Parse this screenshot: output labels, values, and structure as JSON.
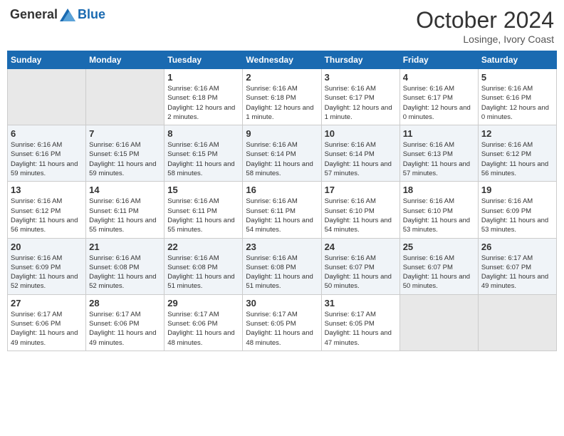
{
  "header": {
    "logo": {
      "general": "General",
      "blue": "Blue"
    },
    "title": "October 2024",
    "location": "Losinge, Ivory Coast"
  },
  "columns": [
    "Sunday",
    "Monday",
    "Tuesday",
    "Wednesday",
    "Thursday",
    "Friday",
    "Saturday"
  ],
  "weeks": [
    [
      {
        "day": "",
        "info": ""
      },
      {
        "day": "",
        "info": ""
      },
      {
        "day": "1",
        "info": "Sunrise: 6:16 AM\nSunset: 6:18 PM\nDaylight: 12 hours\nand 2 minutes."
      },
      {
        "day": "2",
        "info": "Sunrise: 6:16 AM\nSunset: 6:18 PM\nDaylight: 12 hours\nand 1 minute."
      },
      {
        "day": "3",
        "info": "Sunrise: 6:16 AM\nSunset: 6:17 PM\nDaylight: 12 hours\nand 1 minute."
      },
      {
        "day": "4",
        "info": "Sunrise: 6:16 AM\nSunset: 6:17 PM\nDaylight: 12 hours\nand 0 minutes."
      },
      {
        "day": "5",
        "info": "Sunrise: 6:16 AM\nSunset: 6:16 PM\nDaylight: 12 hours\nand 0 minutes."
      }
    ],
    [
      {
        "day": "6",
        "info": "Sunrise: 6:16 AM\nSunset: 6:16 PM\nDaylight: 11 hours\nand 59 minutes."
      },
      {
        "day": "7",
        "info": "Sunrise: 6:16 AM\nSunset: 6:15 PM\nDaylight: 11 hours\nand 59 minutes."
      },
      {
        "day": "8",
        "info": "Sunrise: 6:16 AM\nSunset: 6:15 PM\nDaylight: 11 hours\nand 58 minutes."
      },
      {
        "day": "9",
        "info": "Sunrise: 6:16 AM\nSunset: 6:14 PM\nDaylight: 11 hours\nand 58 minutes."
      },
      {
        "day": "10",
        "info": "Sunrise: 6:16 AM\nSunset: 6:14 PM\nDaylight: 11 hours\nand 57 minutes."
      },
      {
        "day": "11",
        "info": "Sunrise: 6:16 AM\nSunset: 6:13 PM\nDaylight: 11 hours\nand 57 minutes."
      },
      {
        "day": "12",
        "info": "Sunrise: 6:16 AM\nSunset: 6:12 PM\nDaylight: 11 hours\nand 56 minutes."
      }
    ],
    [
      {
        "day": "13",
        "info": "Sunrise: 6:16 AM\nSunset: 6:12 PM\nDaylight: 11 hours\nand 56 minutes."
      },
      {
        "day": "14",
        "info": "Sunrise: 6:16 AM\nSunset: 6:11 PM\nDaylight: 11 hours\nand 55 minutes."
      },
      {
        "day": "15",
        "info": "Sunrise: 6:16 AM\nSunset: 6:11 PM\nDaylight: 11 hours\nand 55 minutes."
      },
      {
        "day": "16",
        "info": "Sunrise: 6:16 AM\nSunset: 6:11 PM\nDaylight: 11 hours\nand 54 minutes."
      },
      {
        "day": "17",
        "info": "Sunrise: 6:16 AM\nSunset: 6:10 PM\nDaylight: 11 hours\nand 54 minutes."
      },
      {
        "day": "18",
        "info": "Sunrise: 6:16 AM\nSunset: 6:10 PM\nDaylight: 11 hours\nand 53 minutes."
      },
      {
        "day": "19",
        "info": "Sunrise: 6:16 AM\nSunset: 6:09 PM\nDaylight: 11 hours\nand 53 minutes."
      }
    ],
    [
      {
        "day": "20",
        "info": "Sunrise: 6:16 AM\nSunset: 6:09 PM\nDaylight: 11 hours\nand 52 minutes."
      },
      {
        "day": "21",
        "info": "Sunrise: 6:16 AM\nSunset: 6:08 PM\nDaylight: 11 hours\nand 52 minutes."
      },
      {
        "day": "22",
        "info": "Sunrise: 6:16 AM\nSunset: 6:08 PM\nDaylight: 11 hours\nand 51 minutes."
      },
      {
        "day": "23",
        "info": "Sunrise: 6:16 AM\nSunset: 6:08 PM\nDaylight: 11 hours\nand 51 minutes."
      },
      {
        "day": "24",
        "info": "Sunrise: 6:16 AM\nSunset: 6:07 PM\nDaylight: 11 hours\nand 50 minutes."
      },
      {
        "day": "25",
        "info": "Sunrise: 6:16 AM\nSunset: 6:07 PM\nDaylight: 11 hours\nand 50 minutes."
      },
      {
        "day": "26",
        "info": "Sunrise: 6:17 AM\nSunset: 6:07 PM\nDaylight: 11 hours\nand 49 minutes."
      }
    ],
    [
      {
        "day": "27",
        "info": "Sunrise: 6:17 AM\nSunset: 6:06 PM\nDaylight: 11 hours\nand 49 minutes."
      },
      {
        "day": "28",
        "info": "Sunrise: 6:17 AM\nSunset: 6:06 PM\nDaylight: 11 hours\nand 49 minutes."
      },
      {
        "day": "29",
        "info": "Sunrise: 6:17 AM\nSunset: 6:06 PM\nDaylight: 11 hours\nand 48 minutes."
      },
      {
        "day": "30",
        "info": "Sunrise: 6:17 AM\nSunset: 6:05 PM\nDaylight: 11 hours\nand 48 minutes."
      },
      {
        "day": "31",
        "info": "Sunrise: 6:17 AM\nSunset: 6:05 PM\nDaylight: 11 hours\nand 47 minutes."
      },
      {
        "day": "",
        "info": ""
      },
      {
        "day": "",
        "info": ""
      }
    ]
  ]
}
